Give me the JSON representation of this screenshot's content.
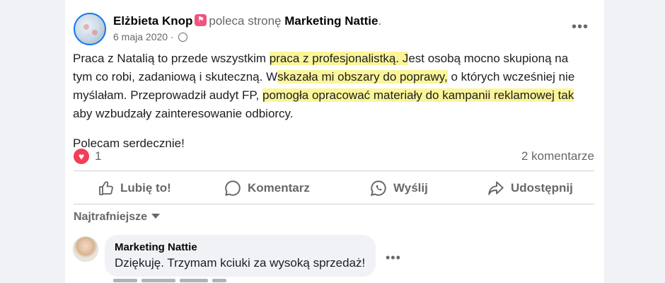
{
  "post": {
    "author": "Elżbieta Knop",
    "badge_icon": "recommend-badge-icon",
    "verb": "poleca stronę",
    "page_name": "Marketing Nattie",
    "page_suffix": ".",
    "date": "6 maja 2020",
    "audience_icon": "globe-icon",
    "more_label": "•••",
    "text": {
      "l1_a": "Praca z Natalią to przede wszystkim ",
      "l1_h": "praca z profesjonalistką. J",
      "l1_b": "est osobą mocno skupioną na",
      "l2_a": "tym co robi, zadaniową i skuteczną. W",
      "l2_h": "skazała mi obszary do poprawy,",
      "l2_b": " o których wcześniej nie",
      "l3_a": "myślałam. Przeprowadził audyt FP, ",
      "l3_h": "pomogła opracować materiały do kampanii reklamowej tak",
      "l4": "aby wzbudzały zainteresowanie odbiorcy.",
      "p2": "Polecam serdecznie!"
    },
    "highlight_color": "#fbf59a"
  },
  "stats": {
    "reaction_icon": "heart-reaction-icon",
    "reaction_count": "1",
    "comments_count": "2 komentarze"
  },
  "actions": {
    "like": "Lubię to!",
    "comment": "Komentarz",
    "send": "Wyślij",
    "share": "Udostępnij"
  },
  "comments": {
    "sort_label": "Najtrafniejsze",
    "items": [
      {
        "author": "Marketing Nattie",
        "text": "Dziękuję. Trzymam kciuki za wysoką sprzedaż!",
        "more_label": "•••"
      }
    ]
  },
  "colors": {
    "accent": "#1877f2",
    "secondary_text": "#65676b",
    "reaction": "#f33e58",
    "badge": "#f0557f"
  }
}
